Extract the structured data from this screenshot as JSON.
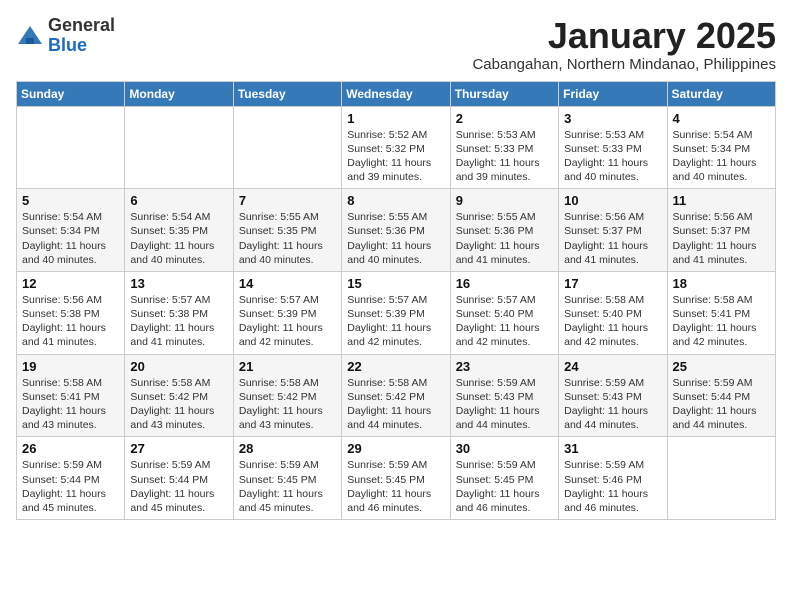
{
  "logo": {
    "general": "General",
    "blue": "Blue"
  },
  "header": {
    "month": "January 2025",
    "location": "Cabangahan, Northern Mindanao, Philippines"
  },
  "weekdays": [
    "Sunday",
    "Monday",
    "Tuesday",
    "Wednesday",
    "Thursday",
    "Friday",
    "Saturday"
  ],
  "weeks": [
    [
      {
        "day": "",
        "info": ""
      },
      {
        "day": "",
        "info": ""
      },
      {
        "day": "",
        "info": ""
      },
      {
        "day": "1",
        "info": "Sunrise: 5:52 AM\nSunset: 5:32 PM\nDaylight: 11 hours and 39 minutes."
      },
      {
        "day": "2",
        "info": "Sunrise: 5:53 AM\nSunset: 5:33 PM\nDaylight: 11 hours and 39 minutes."
      },
      {
        "day": "3",
        "info": "Sunrise: 5:53 AM\nSunset: 5:33 PM\nDaylight: 11 hours and 40 minutes."
      },
      {
        "day": "4",
        "info": "Sunrise: 5:54 AM\nSunset: 5:34 PM\nDaylight: 11 hours and 40 minutes."
      }
    ],
    [
      {
        "day": "5",
        "info": "Sunrise: 5:54 AM\nSunset: 5:34 PM\nDaylight: 11 hours and 40 minutes."
      },
      {
        "day": "6",
        "info": "Sunrise: 5:54 AM\nSunset: 5:35 PM\nDaylight: 11 hours and 40 minutes."
      },
      {
        "day": "7",
        "info": "Sunrise: 5:55 AM\nSunset: 5:35 PM\nDaylight: 11 hours and 40 minutes."
      },
      {
        "day": "8",
        "info": "Sunrise: 5:55 AM\nSunset: 5:36 PM\nDaylight: 11 hours and 40 minutes."
      },
      {
        "day": "9",
        "info": "Sunrise: 5:55 AM\nSunset: 5:36 PM\nDaylight: 11 hours and 41 minutes."
      },
      {
        "day": "10",
        "info": "Sunrise: 5:56 AM\nSunset: 5:37 PM\nDaylight: 11 hours and 41 minutes."
      },
      {
        "day": "11",
        "info": "Sunrise: 5:56 AM\nSunset: 5:37 PM\nDaylight: 11 hours and 41 minutes."
      }
    ],
    [
      {
        "day": "12",
        "info": "Sunrise: 5:56 AM\nSunset: 5:38 PM\nDaylight: 11 hours and 41 minutes."
      },
      {
        "day": "13",
        "info": "Sunrise: 5:57 AM\nSunset: 5:38 PM\nDaylight: 11 hours and 41 minutes."
      },
      {
        "day": "14",
        "info": "Sunrise: 5:57 AM\nSunset: 5:39 PM\nDaylight: 11 hours and 42 minutes."
      },
      {
        "day": "15",
        "info": "Sunrise: 5:57 AM\nSunset: 5:39 PM\nDaylight: 11 hours and 42 minutes."
      },
      {
        "day": "16",
        "info": "Sunrise: 5:57 AM\nSunset: 5:40 PM\nDaylight: 11 hours and 42 minutes."
      },
      {
        "day": "17",
        "info": "Sunrise: 5:58 AM\nSunset: 5:40 PM\nDaylight: 11 hours and 42 minutes."
      },
      {
        "day": "18",
        "info": "Sunrise: 5:58 AM\nSunset: 5:41 PM\nDaylight: 11 hours and 42 minutes."
      }
    ],
    [
      {
        "day": "19",
        "info": "Sunrise: 5:58 AM\nSunset: 5:41 PM\nDaylight: 11 hours and 43 minutes."
      },
      {
        "day": "20",
        "info": "Sunrise: 5:58 AM\nSunset: 5:42 PM\nDaylight: 11 hours and 43 minutes."
      },
      {
        "day": "21",
        "info": "Sunrise: 5:58 AM\nSunset: 5:42 PM\nDaylight: 11 hours and 43 minutes."
      },
      {
        "day": "22",
        "info": "Sunrise: 5:58 AM\nSunset: 5:42 PM\nDaylight: 11 hours and 44 minutes."
      },
      {
        "day": "23",
        "info": "Sunrise: 5:59 AM\nSunset: 5:43 PM\nDaylight: 11 hours and 44 minutes."
      },
      {
        "day": "24",
        "info": "Sunrise: 5:59 AM\nSunset: 5:43 PM\nDaylight: 11 hours and 44 minutes."
      },
      {
        "day": "25",
        "info": "Sunrise: 5:59 AM\nSunset: 5:44 PM\nDaylight: 11 hours and 44 minutes."
      }
    ],
    [
      {
        "day": "26",
        "info": "Sunrise: 5:59 AM\nSunset: 5:44 PM\nDaylight: 11 hours and 45 minutes."
      },
      {
        "day": "27",
        "info": "Sunrise: 5:59 AM\nSunset: 5:44 PM\nDaylight: 11 hours and 45 minutes."
      },
      {
        "day": "28",
        "info": "Sunrise: 5:59 AM\nSunset: 5:45 PM\nDaylight: 11 hours and 45 minutes."
      },
      {
        "day": "29",
        "info": "Sunrise: 5:59 AM\nSunset: 5:45 PM\nDaylight: 11 hours and 46 minutes."
      },
      {
        "day": "30",
        "info": "Sunrise: 5:59 AM\nSunset: 5:45 PM\nDaylight: 11 hours and 46 minutes."
      },
      {
        "day": "31",
        "info": "Sunrise: 5:59 AM\nSunset: 5:46 PM\nDaylight: 11 hours and 46 minutes."
      },
      {
        "day": "",
        "info": ""
      }
    ]
  ]
}
